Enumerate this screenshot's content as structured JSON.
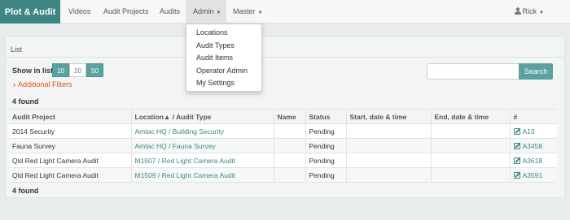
{
  "brand": "Plot & Audit",
  "nav": {
    "videos": "Videos",
    "audit_projects": "Audit Projects",
    "audits": "Audits",
    "admin": "Admin",
    "master": "Master",
    "user": "Rick"
  },
  "admin_menu": [
    "Locations",
    "Audit Types",
    "Audit Items",
    "Operator Admin",
    "My Settings"
  ],
  "tab": "List",
  "show_in_list": {
    "label": "Show in list",
    "options": [
      "10",
      "20",
      "50"
    ],
    "selected": "20"
  },
  "additional_filters": "Additional Filters",
  "search": {
    "button": "Search",
    "value": ""
  },
  "found_text": "4 found",
  "table": {
    "headers": [
      "Audit Project",
      "Location▲ / Audit Type",
      "Name",
      "Status",
      "Start, date & time",
      "End, date & time",
      "#"
    ],
    "rows": [
      {
        "project": "2014 Security",
        "location": "Amtac HQ / Building Security",
        "name": "",
        "status": "Pending",
        "start": "",
        "end": "",
        "id": "A13"
      },
      {
        "project": "Fauna Survey",
        "location": "Amtac HQ / Fauna Survey",
        "name": "",
        "status": "Pending",
        "start": "",
        "end": "",
        "id": "A3458"
      },
      {
        "project": "Qld Red Light Camera Audit",
        "location": "M1507 / Red Light Camera Audit",
        "name": "",
        "status": "Pending",
        "start": "",
        "end": "",
        "id": "A3618"
      },
      {
        "project": "Qld Red Light Camera Audit",
        "location": "M1509 / Red Light Camera Audit",
        "name": "",
        "status": "Pending",
        "start": "",
        "end": "",
        "id": "A3591"
      }
    ]
  },
  "colors": {
    "brand": "#3e8683",
    "accent": "#5aa2a0",
    "filter_link": "#d9541e"
  },
  "icons": {
    "user": "user-icon",
    "edit": "edit-icon",
    "filters": "chevron-right-icon"
  }
}
